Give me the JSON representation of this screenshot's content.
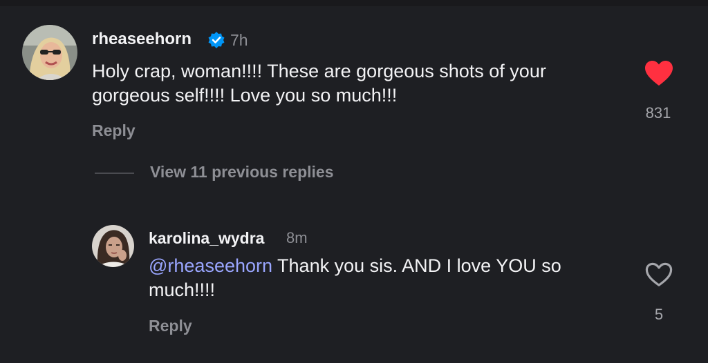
{
  "comments": [
    {
      "username": "rheaseehorn",
      "verified": true,
      "time": "7h",
      "text": "Holy crap, woman!!!! These are gorgeous shots of your gorgeous self!!!! Love you so much!!!",
      "reply_label": "Reply",
      "like_count": "831",
      "liked": true,
      "avatar_icon": "profile-photo"
    }
  ],
  "view_replies_label": "View 11 previous replies",
  "replies": [
    {
      "username": "karolina_wydra",
      "time": "8m",
      "mention": "@rheaseehorn",
      "text": " Thank you sis. AND I love YOU so much!!!!",
      "reply_label": "Reply",
      "like_count": "5",
      "liked": false,
      "avatar_icon": "profile-photo"
    }
  ],
  "colors": {
    "background": "#1e1f23",
    "like_red": "#ff3040",
    "verified_blue": "#0095f6",
    "mention": "#9aa6ff",
    "muted": "#8e8f95"
  }
}
